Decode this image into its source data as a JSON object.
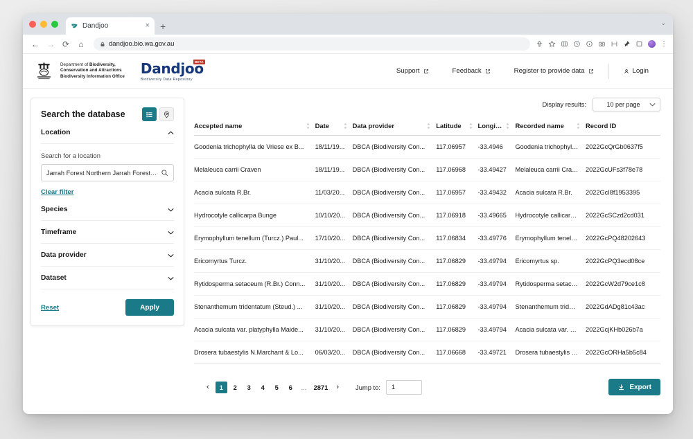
{
  "browser": {
    "tab_title": "Dandjoo",
    "tab_favicon": "leaf-icon",
    "new_tab_label": "+",
    "close_tab_label": "×",
    "url": "dandjoo.bio.wa.gov.au",
    "window_minimize_label": "⌄",
    "kebab_label": "⋮"
  },
  "header": {
    "department_line1": "Department of ",
    "department_line1_bold": "Biodiversity,",
    "department_line2": "Conservation and Attractions",
    "department_line3": "Biodiversity Information Office",
    "wordmark": "Dandjoo",
    "beta_badge": "BETA",
    "wordmark_sub": "Biodiversity Data Repository",
    "nav": [
      {
        "label": "Support",
        "icon": "external-link-icon"
      },
      {
        "label": "Feedback",
        "icon": "external-link-icon"
      },
      {
        "label": "Register to provide data",
        "icon": "external-link-icon"
      }
    ],
    "login_label": "Login",
    "login_icon": "user-icon"
  },
  "sidebar": {
    "title": "Search the database",
    "view_list_icon": "list-view-icon",
    "view_map_icon": "map-pin-icon",
    "location": {
      "label": "Location",
      "field_label": "Search for a location",
      "value": "Jarrah Forest Northern Jarrah Forest (I...",
      "placeholder": "Search for a location",
      "search_icon": "search-icon",
      "clear_filter_label": "Clear filter"
    },
    "sections": [
      {
        "label": "Species"
      },
      {
        "label": "Timeframe"
      },
      {
        "label": "Data provider"
      },
      {
        "label": "Dataset"
      }
    ],
    "reset_label": "Reset",
    "apply_label": "Apply"
  },
  "main": {
    "display_results_label": "Display results:",
    "per_page_value": "10 per page",
    "columns": [
      {
        "label": "Accepted name",
        "sortable": true
      },
      {
        "label": "Date",
        "sortable": true
      },
      {
        "label": "Data provider",
        "sortable": true
      },
      {
        "label": "Latitude",
        "sortable": true
      },
      {
        "label": "Longit...",
        "sortable": true
      },
      {
        "label": "Recorded name",
        "sortable": true
      },
      {
        "label": "Record ID",
        "sortable": false
      }
    ],
    "rows": [
      [
        "Goodenia trichophylla de Vriese ex B...",
        "18/11/19...",
        "DBCA (Biodiversity Con...",
        "117.06957",
        "-33.4946",
        "Goodenia trichophylla ...",
        "2022GcQrGb0637f5"
      ],
      [
        "Melaleuca carrii Craven",
        "18/11/19...",
        "DBCA (Biodiversity Con...",
        "117.06968",
        "-33.49427",
        "Melaleuca carrii Craven",
        "2022GcUFs3f78e78"
      ],
      [
        "Acacia sulcata R.Br.",
        "11/03/20...",
        "DBCA (Biodiversity Con...",
        "117.06957",
        "-33.49432",
        "Acacia sulcata R.Br.",
        "2022GcI8f1953395"
      ],
      [
        "Hydrocotyle callicarpa Bunge",
        "10/10/20...",
        "DBCA (Biodiversity Con...",
        "117.06918",
        "-33.49665",
        "Hydrocotyle callicarpa ...",
        "2022GcSCzd2cd031"
      ],
      [
        "Erymophyllum tenellum (Turcz.) Paul...",
        "17/10/20...",
        "DBCA (Biodiversity Con...",
        "117.06834",
        "-33.49776",
        "Erymophyllum tenellu...",
        "2022GcPQ48202643"
      ],
      [
        "Ericomyrtus Turcz.",
        "31/10/20...",
        "DBCA (Biodiversity Con...",
        "117.06829",
        "-33.49794",
        "Ericomyrtus sp.",
        "2022GcPQ3ecd08ce"
      ],
      [
        "Rytidosperma setaceum (R.Br.) Conn...",
        "31/10/20...",
        "DBCA (Biodiversity Con...",
        "117.06829",
        "-33.49794",
        "Rytidosperma setaceu...",
        "2022GcW2d79ce1c8"
      ],
      [
        "Stenanthemum tridentatum (Steud.) ...",
        "31/10/20...",
        "DBCA (Biodiversity Con...",
        "117.06829",
        "-33.49794",
        "Stenanthemum trident...",
        "2022GdADg81c43ac"
      ],
      [
        "Acacia sulcata var. platyphylla Maide...",
        "31/10/20...",
        "DBCA (Biodiversity Con...",
        "117.06829",
        "-33.49794",
        "Acacia sulcata var. plat...",
        "2022GcjKHb026b7a"
      ],
      [
        "Drosera tubaestylis N.Marchant & Lo...",
        "06/03/20...",
        "DBCA (Biodiversity Con...",
        "117.06668",
        "-33.49721",
        "Drosera tubaestylis N....",
        "2022GcORHa5b5c84"
      ]
    ]
  },
  "pagination": {
    "prev_label": "‹",
    "next_label": "›",
    "pages": [
      "1",
      "2",
      "3",
      "4",
      "5",
      "6"
    ],
    "ellipsis": "...",
    "last_page": "2871",
    "active_page": "1",
    "jump_label": "Jump to:",
    "jump_value": "1",
    "export_label": "Export",
    "export_icon": "download-icon"
  },
  "colors": {
    "teal": "#1a7a88",
    "brand_blue": "#16387a",
    "beta_red": "#c0392b"
  }
}
